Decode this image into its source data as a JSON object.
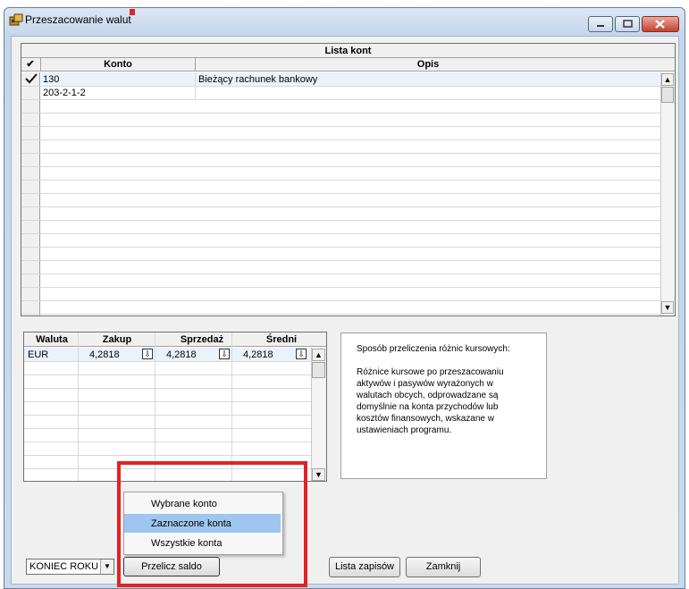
{
  "window": {
    "title": "Przeszacowanie walut"
  },
  "accounts": {
    "caption": "Lista kont",
    "check_header": "✔",
    "col_account": "Konto",
    "col_description": "Opis",
    "rows": [
      {
        "checked": true,
        "account": "130",
        "description": "Bieżący rachunek bankowy"
      },
      {
        "checked": false,
        "account": "203-2-1-2",
        "description": ""
      }
    ]
  },
  "rates": {
    "col_currency": "Waluta",
    "col_buy": "Zakup",
    "col_sell": "Sprzedaż",
    "col_avg": "Średni",
    "rows": [
      {
        "currency": "EUR",
        "buy": "4,2818",
        "sell": "4,2818",
        "avg": "4,2818"
      }
    ]
  },
  "info_text": {
    "line1": "Sposób przeliczenia różnic kursowych:",
    "line2": "Różnice kursowe po przeszacowaniu",
    "line3": "aktywów i pasywów wyrażonych w",
    "line4": "walutach obcych, odprowadzane są",
    "line5": "domyślnie na konta przychodów lub",
    "line6": "kosztów finansowych, wskazane w",
    "line7": "ustawieniach programu."
  },
  "dropdown_menu": {
    "items": [
      "Wybrane konto",
      "Zaznaczone konta",
      "Wszystkie konta"
    ],
    "highlighted_index": 1
  },
  "period_select": {
    "value": "KONIEC ROKU"
  },
  "buttons": {
    "recalc": "Przelicz saldo",
    "entries_list": "Lista zapisów",
    "close": "Zamknij"
  },
  "colors": {
    "highlight": "#9fc6ee",
    "annotation_red": "#e32222"
  }
}
